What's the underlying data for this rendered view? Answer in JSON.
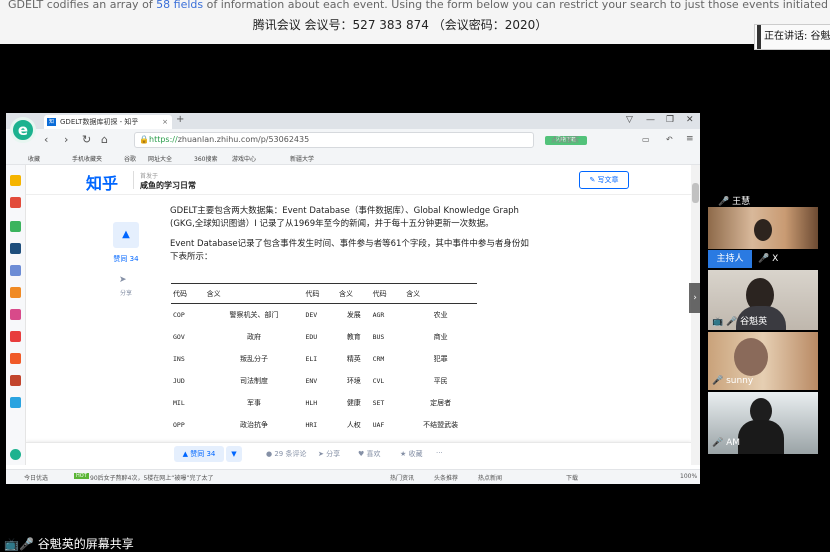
{
  "background": {
    "website_line_prefix": "GDELT codifies an array of ",
    "website_link": "58 fields",
    "website_line_suffix": " of information about each event. Using the form below you can restrict your search to just those events initiated by a specific country and/or"
  },
  "meeting": {
    "title": "腾讯会议 会议号：527 383 874 （会议密码：2020）",
    "speaking": "正在讲话: 谷魁"
  },
  "browser": {
    "logo": "e",
    "tab_title": "GDELT数据库初探 - 知乎",
    "url_prefix": "https://",
    "url_rest": "zhuanlan.zhihu.com/p/53062435",
    "fast_label": "闪电下载",
    "search_placeholder": "点此搜索",
    "bookmarks": [
      "收藏",
      "手机收藏夹",
      "谷歌",
      "网址大全",
      "360搜索",
      "游戏中心",
      "新疆大学"
    ],
    "status": {
      "today": "今日优选",
      "news": "90后女子熬醉4次，5楼在网上“被曝”完了太了",
      "items": [
        "热门资讯",
        "头条推荐",
        "热点新闻",
        "下载",
        "100%"
      ]
    }
  },
  "zhihu": {
    "logo": "知乎",
    "column_small": "首发于",
    "column": "咸鱼的学习日常",
    "write_button": "写文章",
    "vote_label": "赞同 34",
    "share_label": "分享",
    "paragraph1": "GDELT主要包含两大数据集：Event Database（事件数据库）、Global Knowledge Graph (GKG,全球知识图谱）I 记录了从1969年至今的新闻，并于每十五分钟更新一次数据。",
    "paragraph2": "Event Database记录了包含事件发生时间、事件参与者等61个字段，其中事件中参与者身份如下表所示：",
    "table": {
      "headers": [
        "代码",
        "含义",
        "代码",
        "含义",
        "代码",
        "含义"
      ],
      "rows": [
        [
          "COP",
          "警察机关、部门",
          "DEV",
          "发展",
          "AGR",
          "农业"
        ],
        [
          "GOV",
          "政府",
          "EDU",
          "教育",
          "BUS",
          "商业"
        ],
        [
          "INS",
          "叛乱分子",
          "ELI",
          "精英",
          "CRM",
          "犯罪"
        ],
        [
          "JUD",
          "司法制度",
          "ENV",
          "环境",
          "CVL",
          "平民"
        ],
        [
          "MIL",
          "军事",
          "HLH",
          "健康",
          "SET",
          "定居者"
        ],
        [
          "OPP",
          "政治抗争",
          "HRI",
          "人权",
          "UAF",
          "不结盟武装"
        ]
      ]
    },
    "actions": {
      "vote": "▲ 赞同 34",
      "down": "▼",
      "comments": "29 条评论",
      "share": "分享",
      "like": "喜欢",
      "fav": "收藏",
      "more": "···"
    }
  },
  "participants": [
    {
      "name": "王慧",
      "role": ""
    },
    {
      "name": "X",
      "role": "主持人"
    },
    {
      "name": "谷魁英",
      "role": ""
    },
    {
      "name": "sunny",
      "role": ""
    },
    {
      "name": "AM",
      "role": ""
    }
  ],
  "presentation_label": "谷魁英的屏幕共享"
}
